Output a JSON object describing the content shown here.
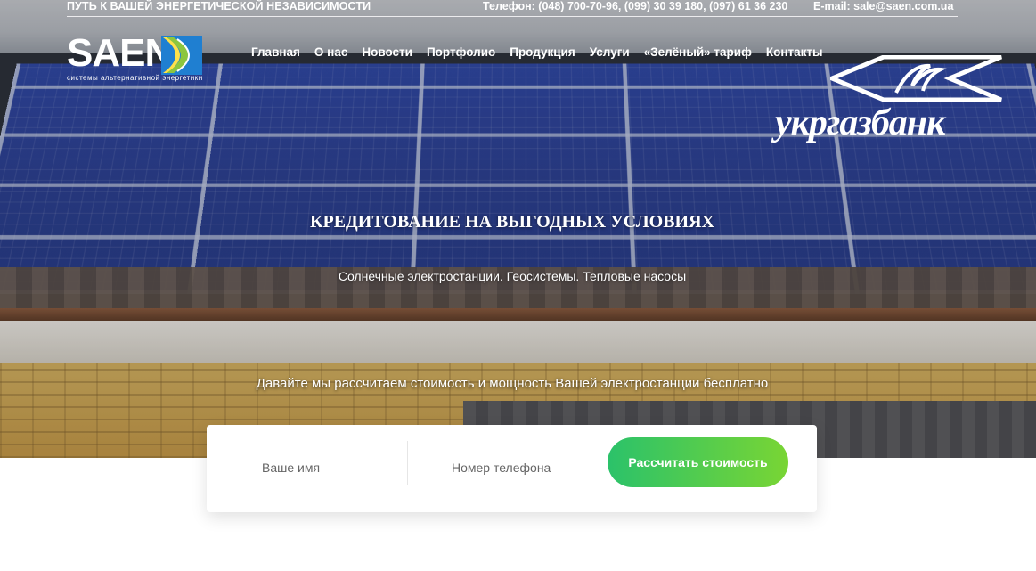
{
  "topbar": {
    "tagline": "ПУТЬ К ВАШЕЙ ЭНЕРГЕТИЧЕСКОЙ НЕЗАВИСИМОСТИ",
    "phones": "Телефон: (048) 700-70-96, (099) 30 39 180, (097) 61 36 230",
    "email": "E-mail: sale@saen.com.ua"
  },
  "logo": {
    "text": "SAEN",
    "subtitle": "системы альтернативной энергетики"
  },
  "nav": {
    "items": [
      "Главная",
      "О нас",
      "Новости",
      "Портфолио",
      "Продукция",
      "Услуги",
      "«Зелёный» тариф",
      "Контакты"
    ]
  },
  "partner": {
    "name": "укргазбанк"
  },
  "hero": {
    "headline": "КРЕДИТОВАНИЕ НА ВЫГОДНЫХ УСЛОВИЯХ",
    "subheadline": "Солнечные электростанции. Геосистемы. Тепловые насосы",
    "offer": "Давайте мы рассчитаем стоимость и мощность Вашей электростанции бесплатно"
  },
  "form": {
    "name_placeholder": "Ваше имя",
    "phone_placeholder": "Номер телефона",
    "submit_label": "Рассчитать стоимость"
  },
  "colors": {
    "cta_start": "#2bc26a",
    "cta_end": "#79d534",
    "logo_accent_blue": "#1f7fd1",
    "logo_accent_green": "#8cc63f"
  }
}
